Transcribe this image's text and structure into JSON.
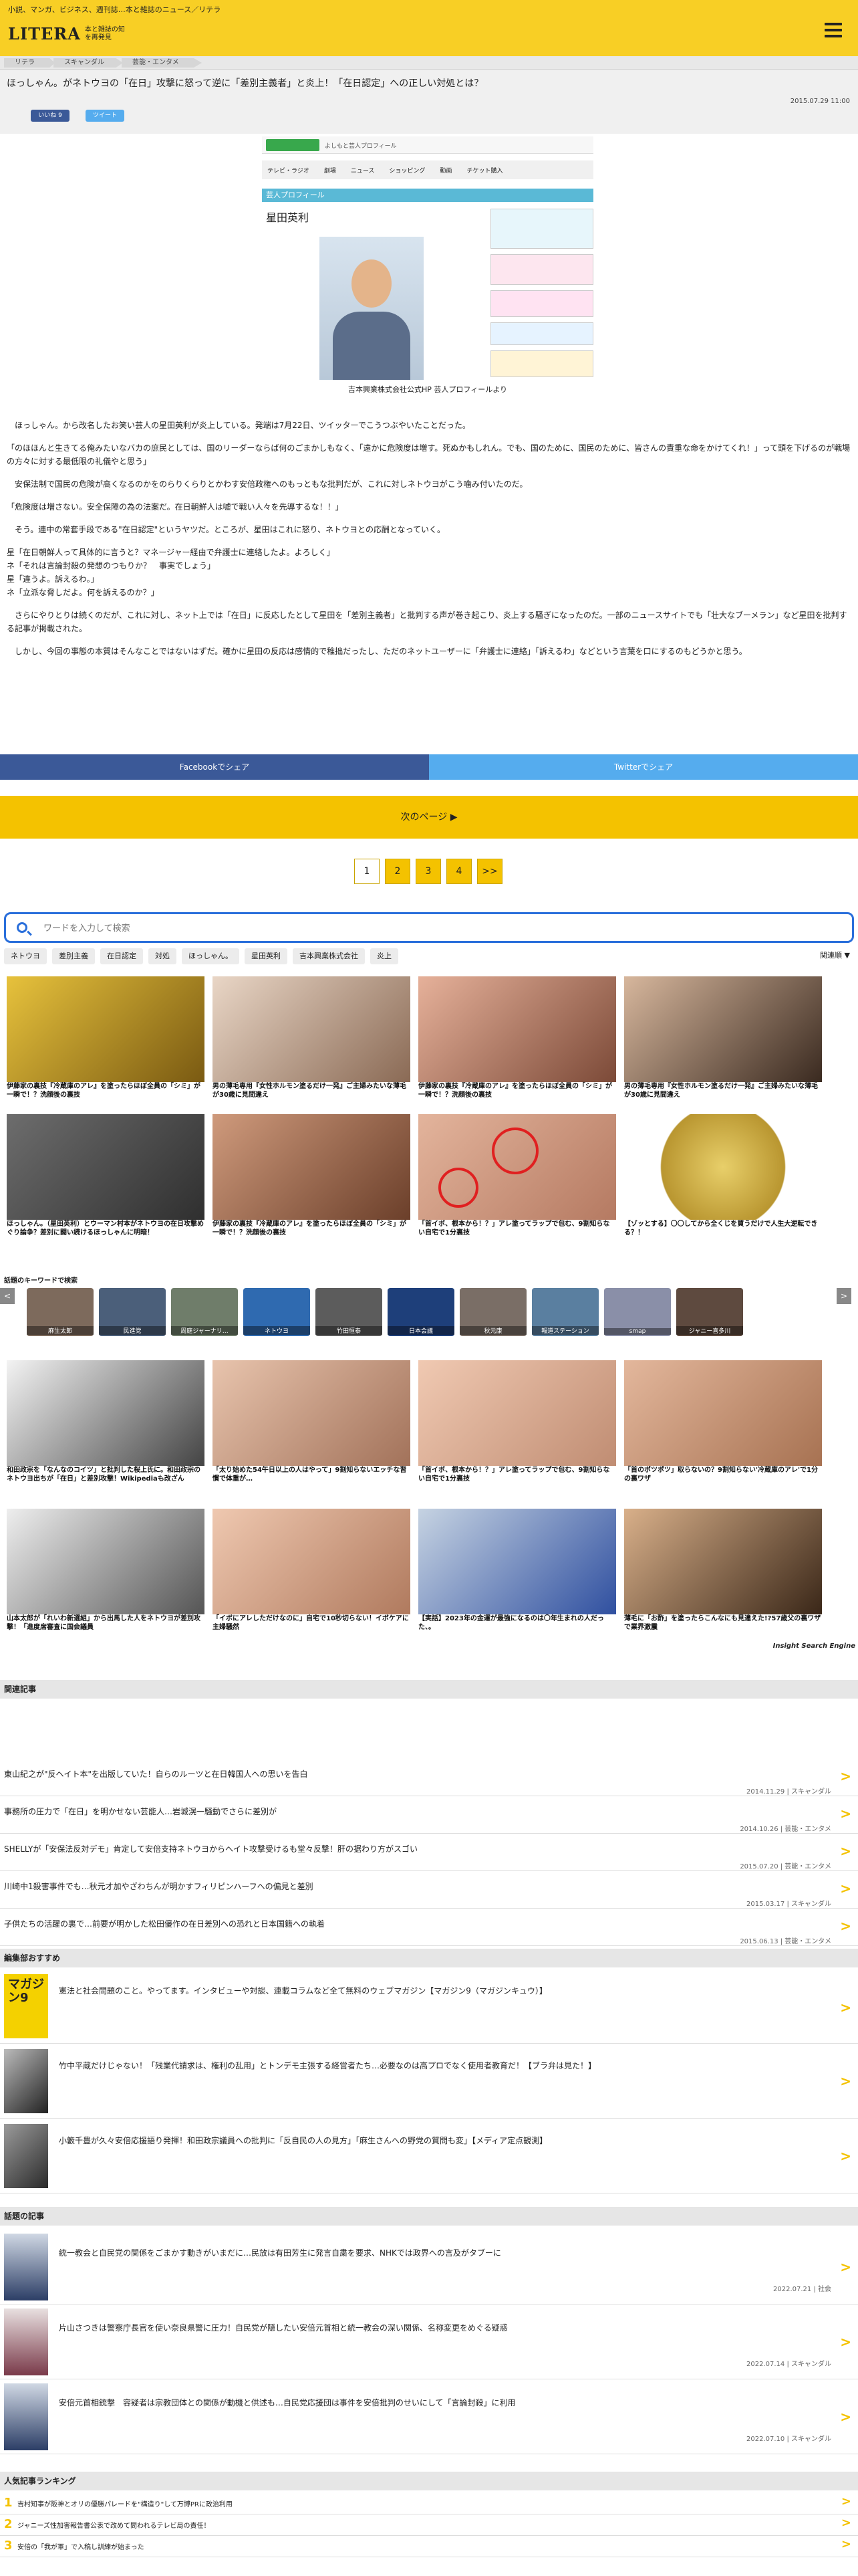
{
  "header": {
    "tagline": "小説、マンガ、ビジネス、週刊誌…本と雑誌のニュース／リテラ",
    "logo_text": "LITERA",
    "logo_sub": "本と雑誌の知を再発見"
  },
  "breadcrumb": [
    "リテラ",
    "スキャンダル",
    "芸能・エンタメ"
  ],
  "article": {
    "title": "ほっしゃん。がネトウヨの「在日」攻撃に怒って逆に「差別主義者」と炎上！「在日認定」への正しい対処とは？",
    "date": "2015.07.29 11:00",
    "fb_count": "いいね 9",
    "tw_count": "ツイート",
    "paragraphs": [
      "ほっしゃん。から改名したお笑い芸人の星田英利が炎上している。発端は7月22日、ツイッターでこうつぶやいたことだった。",
      "「のほほんと生きてる俺みたいなバカの庶民としては、国のリーダーならば何のごまかしもなく、「遠かに危険度は増す。死ぬかもしれん。でも、国のために、国民のために、皆さんの責重な命をかけてくれ！」って頭を下げるのが戦場の方々に対する最低限の礼儀やと思う」",
      "安保法制で国民の危険が高くなるのかをのらりくらりとかわす安倍政権へのもっともな批判だが、これに対しネトウヨがこう噛み付いたのだ。",
      "「危険度は増さない。安全保障の為の法案だ。在日朝鮮人は嘘で戦い人々を先導するな！！」",
      "そう。連中の常套手段である\"在日認定\"というヤツだ。ところが、星田はこれに怒り、ネトウヨとの応酬となっていく。",
      "星「在日朝鮮人って具体的に言うと？マネージャー経由で弁護士に連絡したよ。よろしく」\nネ「それは言論封殺の発想のつもりか？　事実でしょう」\n星「違うよ。訴えるわ。」\nネ「立派な脅しだよ。何を訴えるのか？」",
      "さらにやりとりは続くのだが、これに対し、ネット上では「在日」に反応したとして星田を「差別主義者」と批判する声が巻き起こり、炎上する騒ぎになったのだ。一部のニュースサイトでも「壮大なブーメラン」など星田を批判する記事が掲載された。",
      "しかし、今回の事態の本質はそんなことではないはずだ。確かに星田の反応は感情的で稚拙だったし、ただのネットユーザーに「弁護士に連絡」「訴えるわ」などという言葉を口にするのもどうかと思う。"
    ]
  },
  "embed": {
    "site_label": "よしもと芸人プロフィール",
    "profile_heading": "芸人プロフィール",
    "profile_name": "星田英利",
    "photo_caption": "吉本興業株式会社公式HP 芸人プロフィールより",
    "nav": [
      "テレビ・ラジオ",
      "劇場",
      "ニュース",
      "ショッピング",
      "動画",
      "チケット購入"
    ]
  },
  "share": {
    "facebook": "Facebookでシェア",
    "twitter": "Twitterでシェア"
  },
  "next_page": "次のページ ▶",
  "pager": [
    "1",
    "2",
    "3",
    "4",
    ">>"
  ],
  "search": {
    "placeholder": "ワードを入力して検索",
    "tags": [
      "ネトウヨ",
      "差別主義",
      "在日認定",
      "対処",
      "ほっしゃん。",
      "星田英利",
      "吉本興業株式会社",
      "炎上"
    ],
    "sort": "関連順 ▼"
  },
  "ad_tiles": [
    "伊藤家の裏技『冷蔵庫のアレ』を塗ったらほぼ全員の「シミ」が一瞬で！？洗顔後の裏技",
    "男の薄毛専用『女性ホルモン塗るだけ一発』ご主婦みたいな薄毛が30歳に見間違え",
    "伊藤家の裏技『冷蔵庫のアレ』を塗ったらほぼ全員の「シミ」が一瞬で！？洗顔後の裏技",
    "男の薄毛専用『女性ホルモン塗るだけ一発』ご主婦みたいな薄毛が30歳に見間違え",
    "ほっしゃん。（星田英利）とウーマン村本がネトウヨの在日攻撃めぐり論争？差別に闘い続けるほっしゃんに明暗！",
    "伊藤家の裏技『冷蔵庫のアレ』を塗ったらほぼ全員の「シミ」が一瞬で！？洗顔後の裏技",
    "「首イボ、根本から！？」アレ塗ってラップで包む、9割知らない自宅で1分裏技",
    "【ゾッとする】〇〇してから全くじを買うだけで人生大逆転できる？！",
    "和田政宗を「なんなのコイツ」と批判した桜上氏に。和田政宗のネトウヨ出ちが「在日」と差別攻撃！Wikipediaも改ざん",
    "「太り始めた54午日以上の人はやって」9割知らないエッチな習慣で体重が…",
    "「首イボ、根本から！？」アレ塗ってラップで包む、9割知らない自宅で1分裏技",
    "「首のポツポツ」取らないの？9割知らない'冷蔵庫のアレ'で1分の裏ワザ",
    "山本太郎が「れいわ新選組」から出馬した人をネトウヨが差別攻撃！「進度席審査に国会議員",
    "「イボにアレしただけなのに」自宅で10秒切らない！イボケアに主婦騒然",
    "【実話】2023年の金運が最強になるのは〇年生まれの人だった、。",
    "薄毛に「お酢」を塗ったらこんなにも見違えた!?57歳父の裏ワザで業界激震"
  ],
  "keyword_row": {
    "label": "話題のキーワードで検索",
    "items": [
      "麻生太郎",
      "民進党",
      "周庭ジャーナリ…",
      "ネトウヨ",
      "竹田恒泰",
      "日本会議",
      "秋元康",
      "報道ステーション",
      "smap",
      "ジャニー喜多川"
    ]
  },
  "ad_footer": "Insight Search Engine",
  "related": {
    "heading": "関連記事",
    "items": [
      {
        "title": "東山紀之が\"反ヘイト本\"を出版していた！自らのルーツと在日韓国人への思いを告白",
        "meta": "2014.11.29 | スキャンダル"
      },
      {
        "title": "事務所の圧力で「在日」を明かせない芸能人…岩城滉一騒動でさらに差別が",
        "meta": "2014.10.26 | 芸能・エンタメ"
      },
      {
        "title": "SHELLYが「安保法反対デモ」肯定して安倍支持ネトウヨからヘイト攻撃受けるも堂々反撃！肝の据わり方がスゴい",
        "meta": "2015.07.20 | 芸能・エンタメ"
      },
      {
        "title": "川崎中1殺害事件でも…秋元才加やざわちんが明かすフィリピンハーフへの偏見と差別",
        "meta": "2015.03.17 | スキャンダル"
      },
      {
        "title": "子供たちの活躍の裏で…前要が明かした松田優作の在日差別への恐れと日本国籍への執着",
        "meta": "2015.06.13 | 芸能・エンタメ"
      }
    ]
  },
  "editor_picks": {
    "heading": "編集部おすすめ",
    "items": [
      "憲法と社会問題のこと。やってます。インタビューや対談、連載コラムなど全て無料のウェブマガジン【マガジン9（マガジンキュウ）】",
      "竹中平蔵だけじゃない！「残業代請求は、権利の乱用」とトンデモ主張する経営者たち…必要なのは高プロでなく使用者教育だ！【ブラ弁は見た！】",
      "小籔千豊が久々安倍応援語り発揮！和田政宗議員への批判に「反自民の人の見方」「麻生さんへの野党の質問も変」【メディア定点観測】"
    ],
    "magazine_label": "マガジン9"
  },
  "topic": {
    "heading": "話題の記事",
    "items": [
      {
        "title": "統一教会と自民党の関係をごまかす動きがいまだに…民放は有田芳生に発言自粛を要求、NHKでは政界への言及がタブーに",
        "meta": "2022.07.21 | 社会"
      },
      {
        "title": "片山さつきは警察庁長官を使い奈良県警に圧力！自民党が隠したい安倍元首相と統一教会の深い関係、名称変更をめぐる疑惑",
        "meta": "2022.07.14 | スキャンダル"
      },
      {
        "title": "安倍元首相銃撃　容疑者は宗教団体との関係が動機と供述も…自民党応援団は事件を安倍批判のせいにして「言論封殺」に利用",
        "meta": "2022.07.10 | スキャンダル"
      }
    ]
  },
  "ranking": {
    "heading": "人気記事ランキング",
    "items": [
      "吉村知事が阪神とオリの優勝パレードを\"構造り\"して万博PRに政治利用",
      "ジャニーズ性加害報告書公表で改めて問われるテレビ局の責任！",
      "安倍の「我が軍」で入稿し訓練が始まった"
    ]
  },
  "colors": {
    "brand_yellow": "#f8cf25",
    "facebook": "#3b5998",
    "twitter": "#55acee",
    "search_border": "#2a6fdb"
  }
}
